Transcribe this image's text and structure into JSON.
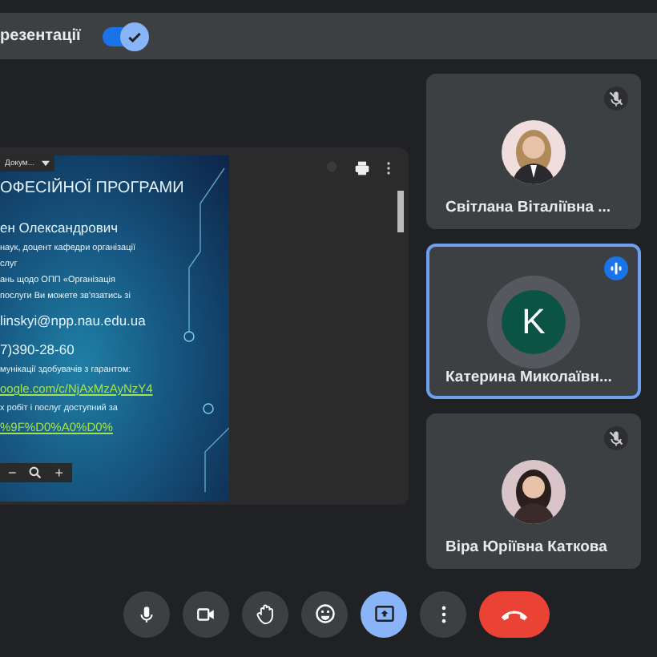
{
  "banner": {
    "label": "резентації",
    "toggle_on": true
  },
  "presentation": {
    "toolbar_label": "Докум...",
    "slide_lines": [
      {
        "text": "ОФЕСІЙНОЇ ПРОГРАМИ",
        "kind": "title"
      },
      {
        "text": "ен Олександрович",
        "kind": "heading"
      },
      {
        "text": "наук, доцент кафедри організації",
        "kind": "body"
      },
      {
        "text": "слуг",
        "kind": "body"
      },
      {
        "text": "ань щодо ОПП «Організація",
        "kind": "body"
      },
      {
        "text": "послуги Ви можете зв'язатись зі",
        "kind": "body"
      },
      {
        "text": "linskyi@npp.nau.edu.ua",
        "kind": "heading"
      },
      {
        "text": "7)390-28-60",
        "kind": "heading"
      },
      {
        "text": "мунікації здобувачів з гарантом:",
        "kind": "body"
      },
      {
        "text": "oogle.com/c/NjAxMzAyNzY4",
        "kind": "link"
      },
      {
        "text": "х робіт і послуг доступний за",
        "kind": "body"
      },
      {
        "text": "%9F%D0%A0%D0%",
        "kind": "link"
      }
    ],
    "zoom_out": "−",
    "zoom_in": "+"
  },
  "participants": [
    {
      "name": "Світлана Віталіївна ...",
      "kind": "picture",
      "muted": true,
      "speaking": false
    },
    {
      "name": "Катерина Миколаївн...",
      "kind": "letter",
      "letter": "K",
      "muted": false,
      "speaking": true
    },
    {
      "name": "Віра Юріївна Каткова",
      "kind": "picture",
      "muted": true,
      "speaking": false
    }
  ],
  "controls": [
    {
      "kind": "mic",
      "active": false
    },
    {
      "kind": "camera",
      "active": false
    },
    {
      "kind": "hand",
      "active": false
    },
    {
      "kind": "emoji",
      "active": false
    },
    {
      "kind": "present",
      "active": true
    },
    {
      "kind": "more",
      "active": false
    },
    {
      "kind": "leave",
      "active": false
    }
  ]
}
